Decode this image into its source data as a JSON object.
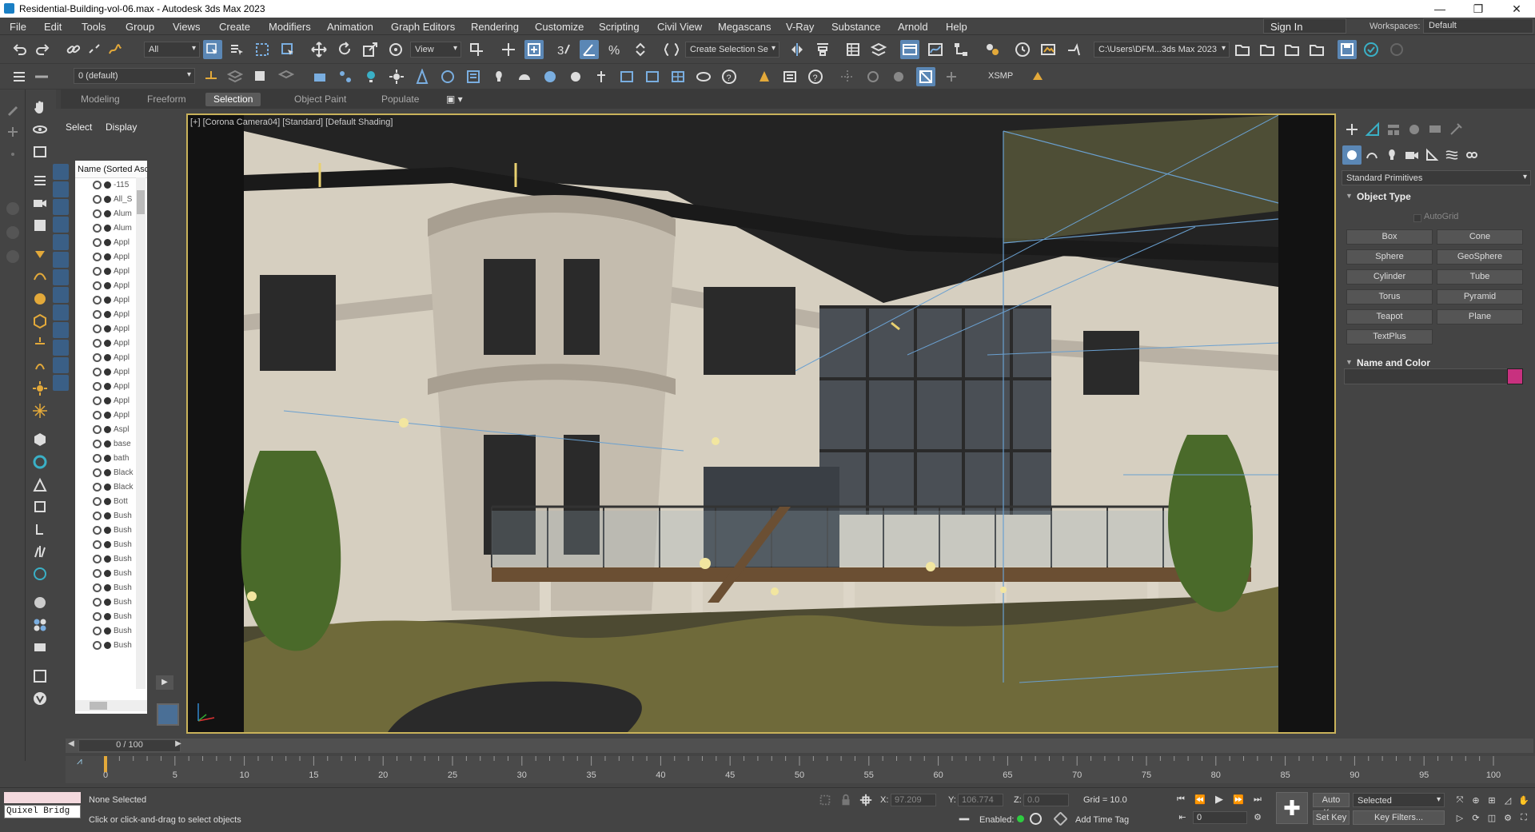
{
  "window": {
    "title": "Residential-Building-vol-06.max - Autodesk 3ds Max 2023",
    "minimize": "—",
    "maximize": "❐",
    "close": "✕"
  },
  "menu": [
    "File",
    "Edit",
    "Tools",
    "Group",
    "Views",
    "Create",
    "Modifiers",
    "Animation",
    "Graph Editors",
    "Rendering",
    "Customize",
    "Scripting",
    "Civil View",
    "Megascans",
    "V-Ray",
    "Substance",
    "Arnold",
    "Help"
  ],
  "account": {
    "sign_in": "Sign In",
    "workspaces_label": "Workspaces:",
    "workspace": "Default"
  },
  "toolbar": {
    "selection_filter": "All",
    "ref_coord": "View",
    "named_selection": "Create Selection Se",
    "project_path": "C:\\Users\\DFM...3ds Max 2023",
    "layer": "0 (default)",
    "xsmp": "XSMP"
  },
  "ribbon_tabs": [
    "Modeling",
    "Freeform",
    "Selection",
    "Object Paint",
    "Populate"
  ],
  "ribbon_active": "Selection",
  "scene_explorer": {
    "select": "Select",
    "display": "Display",
    "column": "Name (Sorted Asce",
    "items": [
      "-115",
      "All_S",
      "Alum",
      "Alum",
      "Appl",
      "Appl",
      "Appl",
      "Appl",
      "Appl",
      "Appl",
      "Appl",
      "Appl",
      "Appl",
      "Appl",
      "Appl",
      "Appl",
      "Appl",
      "Aspl",
      "base",
      "bath",
      "Black",
      "Black",
      "Bott",
      "Bush",
      "Bush",
      "Bush",
      "Bush",
      "Bush",
      "Bush",
      "Bush",
      "Bush",
      "Bush",
      "Bush"
    ]
  },
  "viewport": {
    "label": "[+] [Corona Camera04] [Standard] [Default Shading]"
  },
  "command_panel": {
    "category": "Standard Primitives",
    "object_type": "Object Type",
    "autogrid": "AutoGrid",
    "buttons": [
      "Box",
      "Cone",
      "Sphere",
      "GeoSphere",
      "Cylinder",
      "Tube",
      "Torus",
      "Pyramid",
      "Teapot",
      "Plane",
      "TextPlus"
    ],
    "name_color": "Name and Color",
    "color": "#c8317f"
  },
  "timeline": {
    "frame": "0 / 100",
    "ticks": [
      "0",
      "5",
      "10",
      "15",
      "20",
      "25",
      "30",
      "35",
      "40",
      "45",
      "50",
      "55",
      "60",
      "65",
      "70",
      "75",
      "80",
      "85",
      "90",
      "95",
      "100"
    ]
  },
  "status": {
    "quixel": "Quixel Bridg",
    "selected": "None Selected",
    "prompt": "Click or click-and-drag to select objects",
    "x_label": "X:",
    "x": "97.209",
    "y_label": "Y:",
    "y": "106.774",
    "z_label": "Z:",
    "z": "0.0",
    "grid": "Grid = 10.0",
    "enabled": "Enabled:",
    "add_time_tag": "Add Time Tag",
    "auto_key": "Auto Key",
    "selected_dd": "Selected",
    "set_key": "Set Key",
    "key_filters": "Key Filters...",
    "frame_field": "0"
  }
}
